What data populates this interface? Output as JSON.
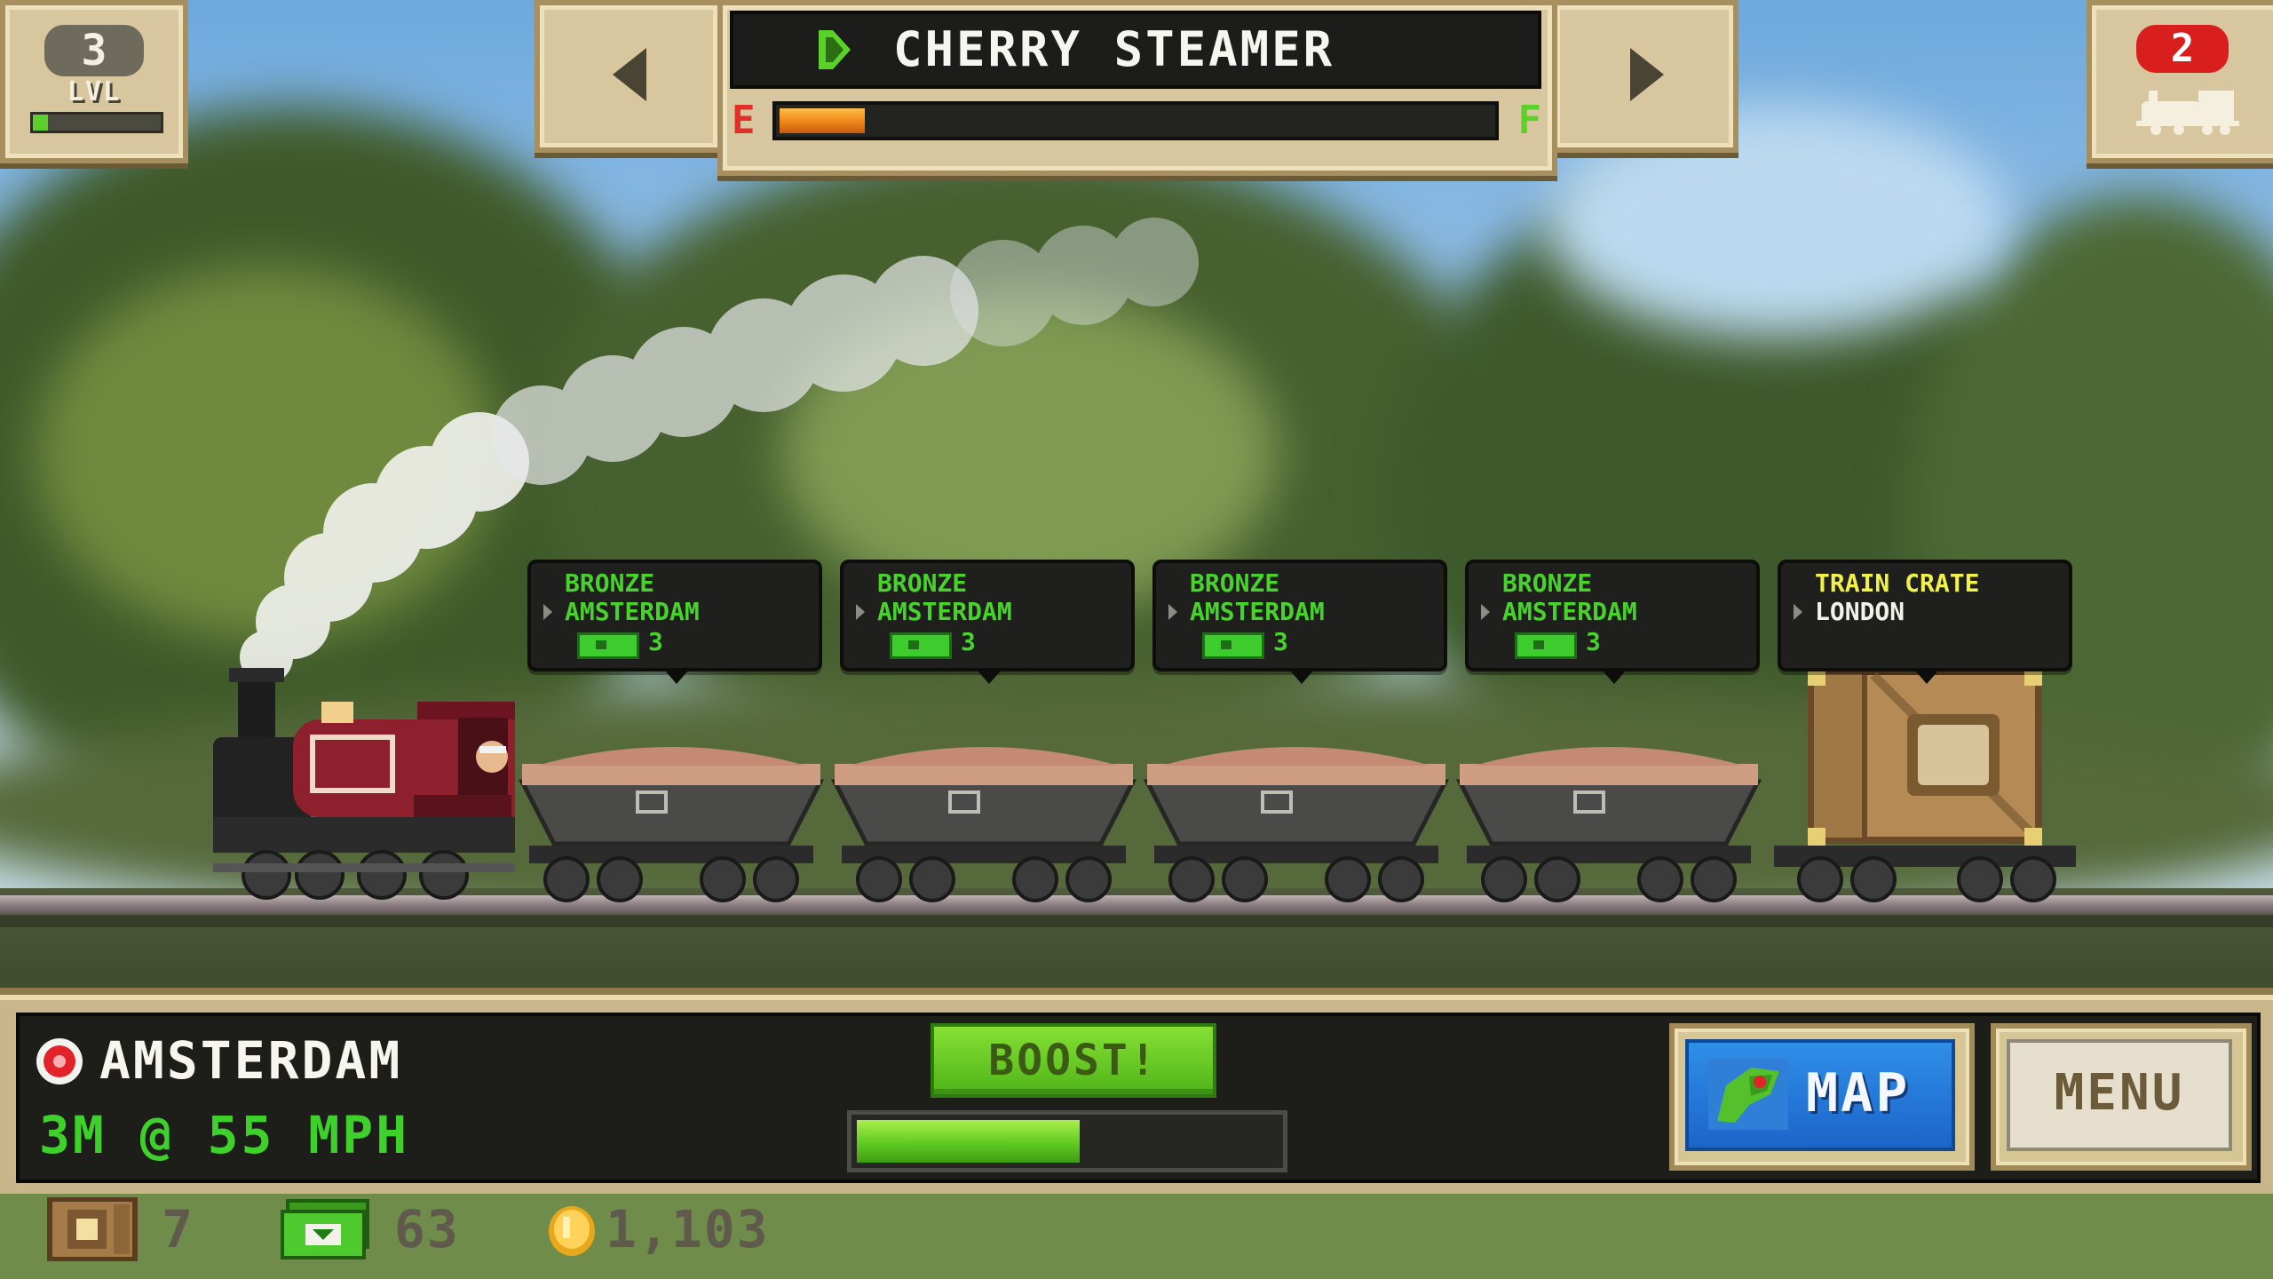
{
  "hud": {
    "level": {
      "number": "3",
      "label": "LVL",
      "progress": 0.12
    },
    "train_name": "CHERRY STEAMER",
    "fuel": {
      "empty_label": "E",
      "full_label": "F",
      "level": 0.12
    },
    "notification_count": "2"
  },
  "cargo_cars": [
    {
      "type": "BRONZE",
      "destination": "AMSTERDAM",
      "reward": "3"
    },
    {
      "type": "BRONZE",
      "destination": "AMSTERDAM",
      "reward": "3"
    },
    {
      "type": "BRONZE",
      "destination": "AMSTERDAM",
      "reward": "3"
    },
    {
      "type": "BRONZE",
      "destination": "AMSTERDAM",
      "reward": "3"
    },
    {
      "type": "TRAIN CRATE",
      "destination": "LONDON",
      "reward": ""
    }
  ],
  "status": {
    "location": "AMSTERDAM",
    "speed_text": "3M @ 55 MPH",
    "boost_label": "BOOST!",
    "boost_level": 0.53,
    "map_label": "MAP",
    "menu_label": "MENU"
  },
  "resources": {
    "crates": "7",
    "bucks": "63",
    "coins": "1,103"
  },
  "colors": {
    "accent_green": "#3fd12b",
    "fuel_orange": "#f18a1a",
    "alert_red": "#d91e1e",
    "frame_tan": "#d8c79e"
  },
  "icons": {
    "fuel_gauge": "pump-icon",
    "location": "red-pin-icon",
    "map": "map-icon",
    "crate": "crate-icon",
    "bucks": "cash-icon",
    "coins": "coin-icon"
  }
}
